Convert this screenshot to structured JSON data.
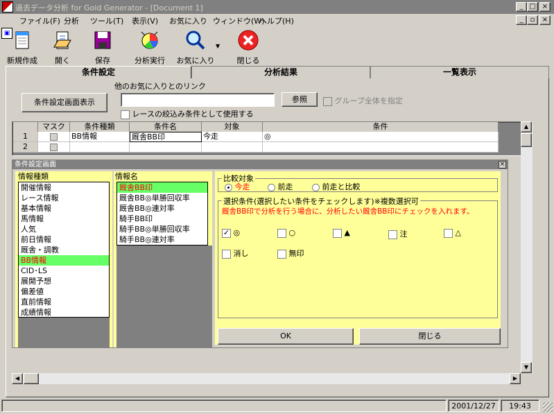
{
  "window": {
    "title": "過去データ分析 for Gold Generator - [Document 1]"
  },
  "menu": [
    "ファイル(F)",
    "分析",
    "ツール(T)",
    "表示(V)",
    "お気に入り",
    "ウィンドウ(W)",
    "ヘルプ(H)"
  ],
  "toolbar": {
    "new": "新規作成",
    "open": "開く",
    "save": "保存",
    "run": "分析実行",
    "favorites": "お気に入り",
    "close": "閉じる"
  },
  "tabs": [
    "条件設定",
    "分析結果",
    "一覧表示"
  ],
  "top": {
    "show_button": "条件設定画面表示",
    "fav_link_label": "他のお気に入りとのリンク",
    "fav_link_value": "",
    "browse_button": "参照",
    "group_label": "グループ全体を指定",
    "narrow_label": "レースの絞込み条件として使用する"
  },
  "grid": {
    "headers": [
      "マスク",
      "条件種類",
      "条件名",
      "対象",
      "条件"
    ],
    "rows": [
      {
        "no": "1",
        "kind": "BB情報",
        "name": "厩舎BB印",
        "target": "今走",
        "cond": "◎"
      },
      {
        "no": "2",
        "kind": "",
        "name": "",
        "target": "",
        "cond": ""
      }
    ]
  },
  "panel": {
    "title": "条件設定画面",
    "info_type_label": "情報種類",
    "info_types": [
      "開催情報",
      "レース情報",
      "基本情報",
      "馬情報",
      "人気",
      "前日情報",
      "厩舎・調教",
      "BB情報",
      "CID･LS",
      "展開予想",
      "偏差値",
      "直前情報",
      "成績情報"
    ],
    "selected_type": "BB情報",
    "info_name_label": "情報名",
    "info_names": [
      "厩舎BB印",
      "厩舎BB◎単勝回収率",
      "厩舎BB◎連対率",
      "騎手BB印",
      "騎手BB◎単勝回収率",
      "騎手BB◎連対率"
    ],
    "selected_name": "厩舎BB印",
    "compare_label": "比較対象",
    "compare_options": [
      "今走",
      "前走",
      "前走と比較"
    ],
    "compare_selected": "今走",
    "select_label": "選択条件(選択したい条件をチェックします)※複数選択可",
    "hint": "厩舎BB印で分析を行う場合に、分析したい厩舎BB印にチェックを入れます。",
    "marks": [
      {
        "label": "◎",
        "checked": true
      },
      {
        "label": "○",
        "checked": false
      },
      {
        "label": "▲",
        "checked": false
      },
      {
        "label": "注",
        "checked": false
      },
      {
        "label": "△",
        "checked": false
      },
      {
        "label": "消し",
        "checked": false
      },
      {
        "label": "無印",
        "checked": false
      }
    ],
    "ok": "OK",
    "close": "閉じる"
  },
  "status": {
    "date": "2001/12/27",
    "time": "19:43"
  },
  "colors": {
    "highlight_green": "#66ff66",
    "panel_yellow": "#ffff99",
    "hint_red": "#ff0000"
  }
}
